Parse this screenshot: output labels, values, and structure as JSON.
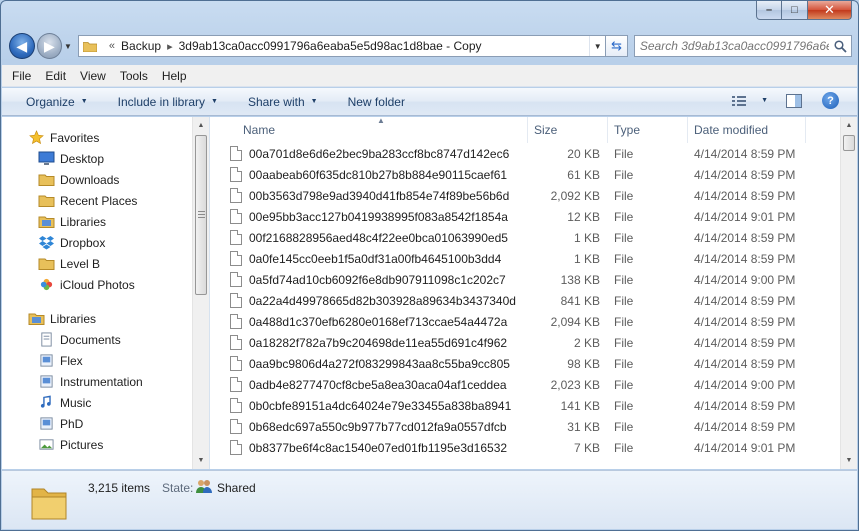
{
  "window": {
    "caption": {
      "minimize": "–",
      "maximize": "□",
      "close": "✕"
    }
  },
  "address": {
    "overflow": "«",
    "crumbs": [
      "Backup",
      "3d9ab13ca0acc0991796a6eaba5e5d98ac1d8bae - Copy"
    ],
    "separator": "▸"
  },
  "search": {
    "placeholder": "Search 3d9ab13ca0acc0991796a6e..."
  },
  "menu": [
    "File",
    "Edit",
    "View",
    "Tools",
    "Help"
  ],
  "commands": {
    "organize": "Organize",
    "include_in_library": "Include in library",
    "share_with": "Share with",
    "new_folder": "New folder",
    "help": "?"
  },
  "nav": {
    "favorites": {
      "label": "Favorites",
      "items": [
        "Desktop",
        "Downloads",
        "Recent Places",
        "Libraries",
        "Dropbox",
        "Level B",
        "iCloud Photos"
      ]
    },
    "libraries": {
      "label": "Libraries",
      "items": [
        "Documents",
        "Flex",
        "Instrumentation",
        "Music",
        "PhD",
        "Pictures"
      ]
    }
  },
  "columns": {
    "name": "Name",
    "size": "Size",
    "type": "Type",
    "date": "Date modified"
  },
  "files": [
    {
      "name": "00a701d8e6d6e2bec9ba283ccf8bc8747d142ec6",
      "size": "20 KB",
      "type": "File",
      "date": "4/14/2014 8:59 PM"
    },
    {
      "name": "00aabeab60f635dc810b27b8b884e90115caef61",
      "size": "61 KB",
      "type": "File",
      "date": "4/14/2014 8:59 PM"
    },
    {
      "name": "00b3563d798e9ad3940d41fb854e74f89be56b6d",
      "size": "2,092 KB",
      "type": "File",
      "date": "4/14/2014 8:59 PM"
    },
    {
      "name": "00e95bb3acc127b0419938995f083a8542f1854a",
      "size": "12 KB",
      "type": "File",
      "date": "4/14/2014 9:01 PM"
    },
    {
      "name": "00f2168828956aed48c4f22ee0bca01063990ed5",
      "size": "1 KB",
      "type": "File",
      "date": "4/14/2014 8:59 PM"
    },
    {
      "name": "0a0fe145cc0eeb1f5a0df31a00fb4645100b3dd4",
      "size": "1 KB",
      "type": "File",
      "date": "4/14/2014 8:59 PM"
    },
    {
      "name": "0a5fd74ad10cb6092f6e8db907911098c1c202c7",
      "size": "138 KB",
      "type": "File",
      "date": "4/14/2014 9:00 PM"
    },
    {
      "name": "0a22a4d49978665d82b303928a89634b3437340d",
      "size": "841 KB",
      "type": "File",
      "date": "4/14/2014 8:59 PM"
    },
    {
      "name": "0a488d1c370efb6280e0168ef713ccae54a4472a",
      "size": "2,094 KB",
      "type": "File",
      "date": "4/14/2014 8:59 PM"
    },
    {
      "name": "0a18282f782a7b9c204698de11ea55d691c4f962",
      "size": "2 KB",
      "type": "File",
      "date": "4/14/2014 8:59 PM"
    },
    {
      "name": "0aa9bc9806d4a272f083299843aa8c55ba9cc805",
      "size": "98 KB",
      "type": "File",
      "date": "4/14/2014 8:59 PM"
    },
    {
      "name": "0adb4e8277470cf8cbe5a8ea30aca04af1ceddea",
      "size": "2,023 KB",
      "type": "File",
      "date": "4/14/2014 9:00 PM"
    },
    {
      "name": "0b0cbfe89151a4dc64024e79e33455a838ba8941",
      "size": "141 KB",
      "type": "File",
      "date": "4/14/2014 8:59 PM"
    },
    {
      "name": "0b68edc697a550c9b977b77cd012fa9a0557dfcb",
      "size": "31 KB",
      "type": "File",
      "date": "4/14/2014 8:59 PM"
    },
    {
      "name": "0b8377be6f4c8ac1540e07ed01fb1195e3d16532",
      "size": "7 KB",
      "type": "File",
      "date": "4/14/2014 9:01 PM"
    }
  ],
  "details": {
    "item_count": "3,215 items",
    "state_label": "State:",
    "state_value": "Shared"
  },
  "icons": {
    "folder": "folder-icon",
    "star": "star-icon",
    "desktop": "desktop-icon",
    "library": "library-icon",
    "dropbox": "dropbox-icon",
    "icloud": "icloud-photos-icon",
    "music": "music-icon",
    "pictures": "pictures-icon",
    "search": "search-icon",
    "refresh": "refresh-icon",
    "help": "help-icon",
    "shared": "shared-users-icon"
  },
  "colors": {
    "accent": "#1e3f68",
    "frame": "#b9d1ea",
    "close": "#c2391c"
  }
}
